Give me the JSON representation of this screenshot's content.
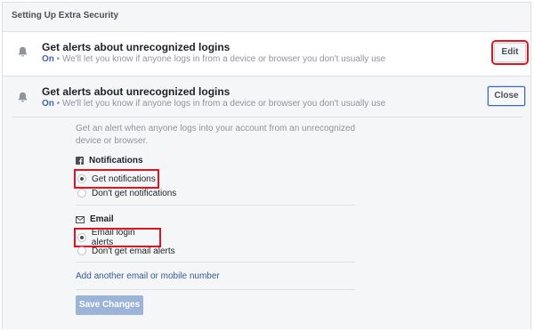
{
  "header": {
    "title": "Setting Up Extra Security"
  },
  "collapsed_row": {
    "title": "Get alerts about unrecognized logins",
    "status": "On",
    "description": " • We'll let you know if anyone logs in from a device or browser you don't usually use",
    "button_label": "Edit"
  },
  "expanded_row": {
    "title": "Get alerts about unrecognized logins",
    "status": "On",
    "description": " • We'll let you know if anyone logs in from a device or browser you don't usually use",
    "button_label": "Close",
    "intro": "Get an alert when anyone logs into your account from an unrecognized device or browser.",
    "notifications": {
      "title": "Notifications",
      "options": [
        "Get notifications",
        "Don't get notifications"
      ],
      "selected": "Get notifications"
    },
    "email": {
      "title": "Email",
      "options": [
        "Email login alerts",
        "Don't get email alerts"
      ],
      "selected": "Email login alerts"
    },
    "add_link": "Add another email or mobile number",
    "save_label": "Save Changes"
  },
  "colors": {
    "highlight_box": "#e0141e",
    "link": "#365899",
    "status_on": "#4267b2",
    "save_disabled": "#9cb4d8"
  },
  "icons": {
    "bell": "bell-icon",
    "notifications": "facebook-square-icon",
    "email": "envelope-icon"
  }
}
